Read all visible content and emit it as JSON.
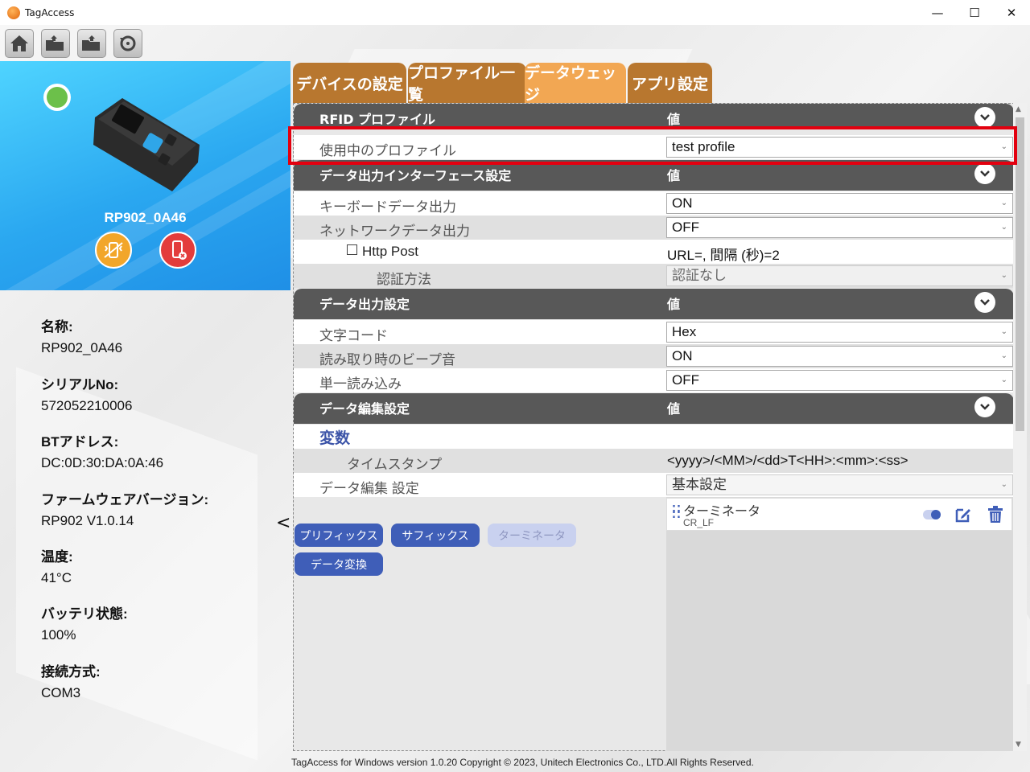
{
  "window": {
    "title": "TagAccess",
    "min": "—",
    "max": "☐",
    "close": "✕"
  },
  "toolbar": {
    "icons": [
      "home-icon",
      "folder-open-icon",
      "folder-save-icon",
      "refresh-icon"
    ]
  },
  "device": {
    "name": "RP902_0A46",
    "status_color": "#6cc04a",
    "info": [
      {
        "label": "名称:",
        "value": "RP902_0A46"
      },
      {
        "label": "シリアルNo:",
        "value": "572052210006"
      },
      {
        "label": "BTアドレス:",
        "value": "DC:0D:30:DA:0A:46"
      },
      {
        "label": "ファームウェアバージョン:",
        "value": "RP902 V1.0.14"
      },
      {
        "label": "温度:",
        "value": "41°C"
      },
      {
        "label": "バッテリ状態:",
        "value": "100%"
      },
      {
        "label": "接続方式:",
        "value": "COM3"
      }
    ]
  },
  "collapse_glyph": "<",
  "tabs": [
    {
      "label": "デバイスの設定",
      "active": false
    },
    {
      "label": "プロファイル一覧",
      "active": false
    },
    {
      "label": "データウェッジ",
      "active": true
    },
    {
      "label": "アプリ設定",
      "active": false
    }
  ],
  "value_header": "値",
  "sections": {
    "rfid": {
      "title": "RFID プロファイル"
    },
    "interface": {
      "title": "データ出力インターフェース設定"
    },
    "output": {
      "title": "データ出力設定"
    },
    "edit": {
      "title": "データ編集設定"
    }
  },
  "rows": {
    "profile": {
      "label": "使用中のプロファイル",
      "value": "test profile"
    },
    "keyboard": {
      "label": "キーボードデータ出力",
      "value": "ON"
    },
    "network": {
      "label": "ネットワークデータ出力",
      "value": "OFF"
    },
    "http": {
      "label": "Http Post",
      "value": "URL=, 間隔 (秒)=2"
    },
    "auth": {
      "label": "認証方法",
      "value": "認証なし"
    },
    "charcode": {
      "label": "文字コード",
      "value": "Hex"
    },
    "beep": {
      "label": "読み取り時のビープ音",
      "value": "ON"
    },
    "single": {
      "label": "単一読み込み",
      "value": "OFF"
    },
    "variables": {
      "label": "変数"
    },
    "timestamp": {
      "label": "タイムスタンプ",
      "value": "<yyyy>/<MM>/<dd>T<HH>:<mm>:<ss>"
    },
    "edit_setting": {
      "label": "データ編集 設定",
      "value": "基本設定"
    }
  },
  "edit_buttons": {
    "prefix": "プリフィックス",
    "suffix": "サフィックス",
    "terminator": "ターミネータ",
    "convert": "データ変換"
  },
  "terminator_item": {
    "name": "ターミネータ",
    "code": "CR_LF",
    "enabled": true
  },
  "footer": "TagAccess for Windows version 1.0.20 Copyright © 2023, Unitech Electronics Co., LTD.All Rights Reserved.",
  "colors": {
    "accent": "#3f5eb8",
    "tab": "#b8772f",
    "tab_active": "#f2a753",
    "highlight": "#e3000f"
  }
}
